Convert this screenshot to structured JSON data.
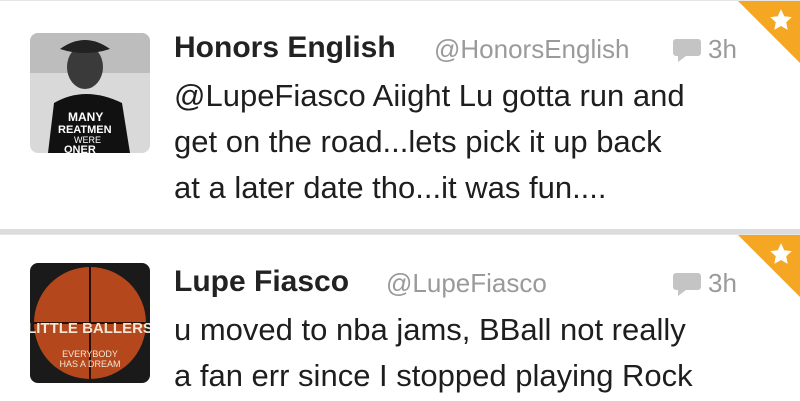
{
  "tweets": [
    {
      "name": "Honors English",
      "handle": "@HonorsEnglish",
      "time": "3h",
      "text": [
        "@LupeFiasco Aiight Lu gotta run and",
        "get on the road...lets pick it up back",
        "at a later date tho...it was fun...."
      ],
      "avatar_shirt_text": [
        "MANY",
        "REATMEN",
        "WERE",
        "ONER"
      ]
    },
    {
      "name": "Lupe Fiasco",
      "handle": "@LupeFiasco",
      "time": "3h",
      "text": [
        "u moved to nba jams, BBall not really",
        "a fan err since I stopped playing Rock"
      ],
      "avatar_ball_text": [
        "LITTLE BALLERS",
        "EVERYBODY",
        "HAS A DREAM"
      ]
    }
  ],
  "colors": {
    "favorite_corner": "#f5a623",
    "muted": "#9a9a9a"
  },
  "icons": {
    "reply": "reply-bubble-icon",
    "favorite": "star-icon"
  }
}
